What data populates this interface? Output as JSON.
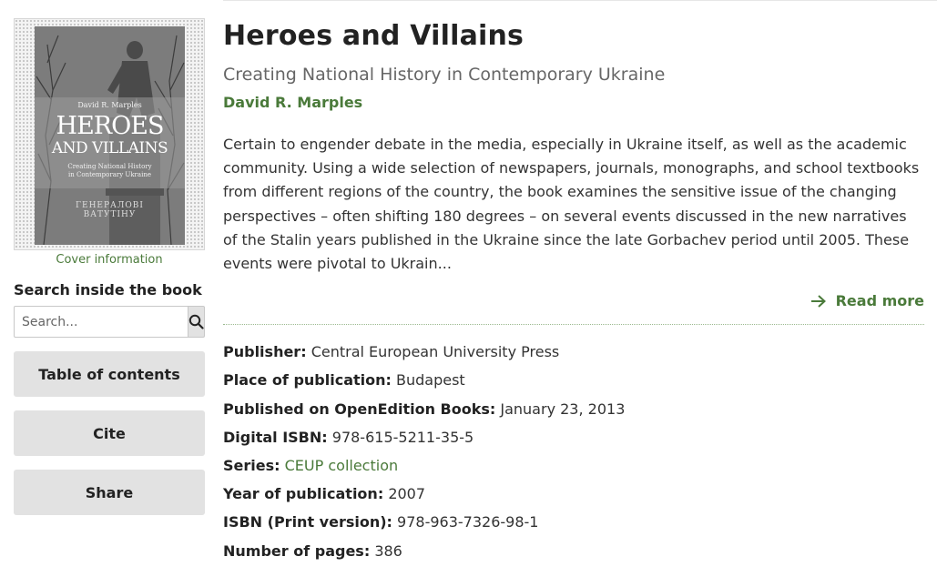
{
  "cover": {
    "author": "David R. Marples",
    "title_line1": "HEROES",
    "title_line2": "AND VILLAINS",
    "subtitle_line1": "Creating National History",
    "subtitle_line2": "in Contemporary Ukraine",
    "plaque_line1": "ГЕНЕРАЛОВІ",
    "plaque_line2": "ВАТУТІНУ",
    "info_link": "Cover information"
  },
  "search": {
    "title": "Search inside the book",
    "placeholder": "Search..."
  },
  "sidebar": {
    "buttons": [
      "Table of contents",
      "Cite",
      "Share"
    ]
  },
  "book": {
    "title": "Heroes and Villains",
    "subtitle": "Creating National History in Contemporary Ukraine",
    "author": "David R. Marples",
    "abstract": "Certain to engender debate in the media, especially in Ukraine itself, as well as the academic community. Using a wide selection of newspapers, journals, monographs, and school textbooks from different regions of the country, the book examines the sensitive issue of the changing perspectives – often shifting 180 degrees – on several events discussed in the new narratives of the Stalin years published in the Ukraine since the late Gorbachev period until 2005. These events were pivotal to Ukrain...",
    "read_more": "Read more"
  },
  "metadata": [
    {
      "label": "Publisher:",
      "value": "Central European University Press"
    },
    {
      "label": "Place of publication:",
      "value": "Budapest"
    },
    {
      "label": "Published on OpenEdition Books:",
      "value": "January 23, 2013"
    },
    {
      "label": "Digital ISBN:",
      "value": "978-615-5211-35-5"
    },
    {
      "label": "Series:",
      "value": "CEUP collection"
    },
    {
      "label": "Year of publication:",
      "value": "2007"
    },
    {
      "label": "ISBN (Print version):",
      "value": "978-963-7326-98-1"
    },
    {
      "label": "Number of pages:",
      "value": "386"
    }
  ],
  "colors": {
    "accent_green": "#4a7a3a",
    "button_gray": "#e2e2e2"
  },
  "icons": {
    "search": "search-icon",
    "read_more": "arrow-right-icon"
  }
}
